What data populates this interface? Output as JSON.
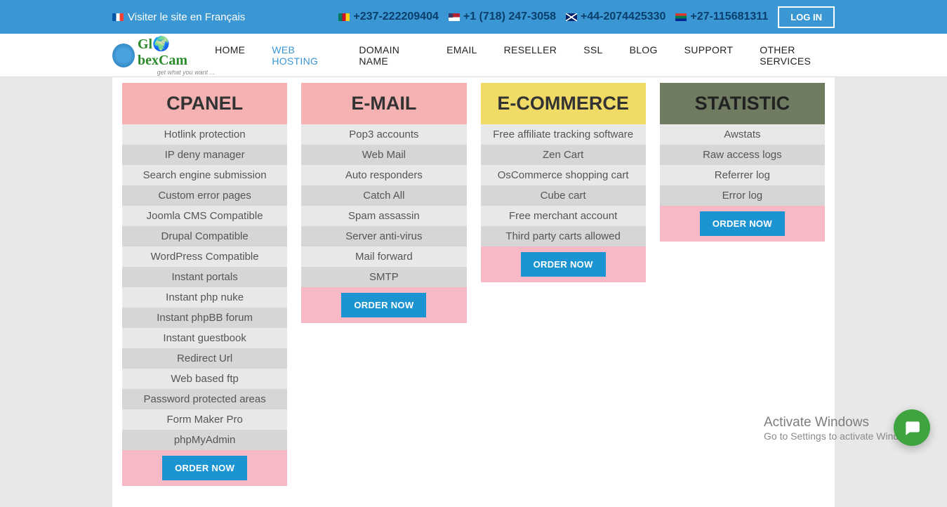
{
  "topbar": {
    "lang_text": "Visiter le site en Français",
    "phones": [
      {
        "flag": "cm",
        "num": "+237-222209404"
      },
      {
        "flag": "us",
        "num": "+1 (718) 247-3058"
      },
      {
        "flag": "uk",
        "num": "+44-2074425330"
      },
      {
        "flag": "za",
        "num": "+27-115681311"
      }
    ],
    "login": "LOG IN"
  },
  "logo": {
    "brand_a": "Gl",
    "brand_b": "bexCam",
    "tag": "get what you want ..."
  },
  "nav": [
    {
      "label": "HOME",
      "active": false
    },
    {
      "label": "WEB HOSTING",
      "active": true
    },
    {
      "label": "DOMAIN NAME",
      "active": false
    },
    {
      "label": "EMAIL",
      "active": false
    },
    {
      "label": "RESELLER",
      "active": false
    },
    {
      "label": "SSL",
      "active": false
    },
    {
      "label": "BLOG",
      "active": false
    },
    {
      "label": "SUPPORT",
      "active": false
    },
    {
      "label": "OTHER SERVICES",
      "active": false
    }
  ],
  "columns": [
    {
      "title": "CPANEL",
      "header_class": "h-pink",
      "features": [
        "Hotlink protection",
        "IP deny manager",
        "Search engine submission",
        "Custom error pages",
        "Joomla CMS Compatible",
        "Drupal Compatible",
        "WordPress Compatible",
        "Instant portals",
        "Instant php nuke",
        "Instant phpBB forum",
        "Instant guestbook",
        "Redirect Url",
        "Web based ftp",
        "Password protected areas",
        "Form Maker Pro",
        "phpMyAdmin"
      ]
    },
    {
      "title": "E-MAIL",
      "header_class": "h-pink",
      "features": [
        "Pop3 accounts",
        "Web Mail",
        "Auto responders",
        "Catch All",
        "Spam assassin",
        "Server anti-virus",
        "Mail forward",
        "SMTP"
      ]
    },
    {
      "title": "E-COMMERCE",
      "header_class": "h-yellow",
      "features": [
        "Free affiliate tracking software",
        "Zen Cart",
        "OsCommerce shopping cart",
        "Cube cart",
        "Free merchant account",
        "Third party carts allowed"
      ]
    },
    {
      "title": "STATISTIC",
      "header_class": "h-olive",
      "features": [
        "Awstats",
        "Raw access logs",
        "Referrer log",
        "Error log"
      ]
    }
  ],
  "order_label": "ORDER NOW",
  "watermark": {
    "title": "Activate Windows",
    "sub": "Go to Settings to activate Windows."
  }
}
